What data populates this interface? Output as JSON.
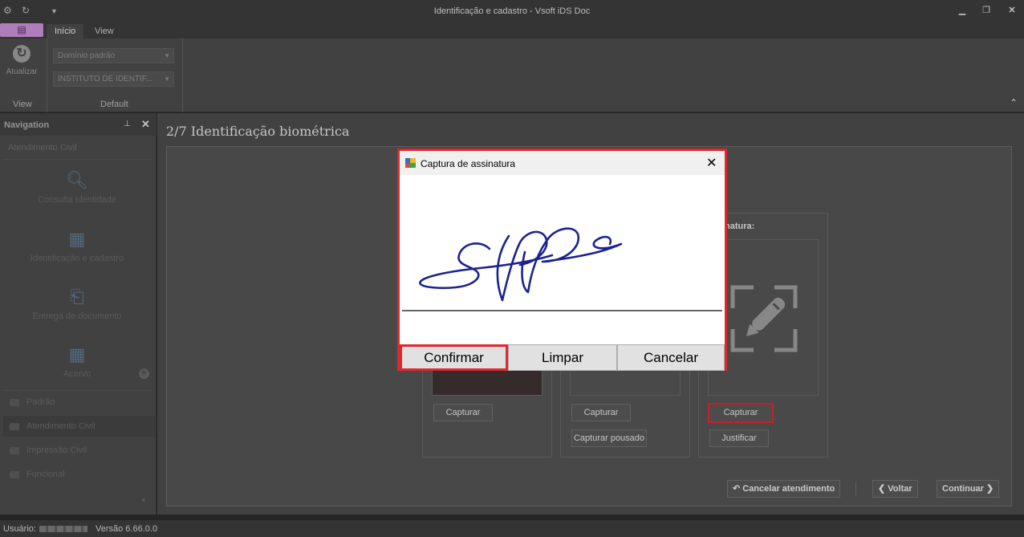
{
  "window": {
    "title": "Identificação e cadastro - Vsoft iDS Doc",
    "controls": [
      "minimize-icon",
      "restore-icon",
      "close-icon"
    ]
  },
  "quick_access": [
    "app-icon",
    "undo-icon",
    "dropdown-icon"
  ],
  "ribbon": {
    "file_button_icon": "document-icon",
    "tabs": [
      {
        "label": "Início",
        "active": true
      },
      {
        "label": "View",
        "active": false
      }
    ],
    "refresh_label": "Atualizar",
    "domain_combo": "Domínio padrão",
    "institute_combo": "INSTITUTO DE IDENTIF...",
    "group_view": "View",
    "group_default": "Default"
  },
  "navigation": {
    "title": "Navigation",
    "section": "Atendimento Civil",
    "items": [
      {
        "label": "Consulta Identidade",
        "icon": "search-icon"
      },
      {
        "label": "Identificação e cadastro",
        "icon": "id-card-icon"
      },
      {
        "label": "Entrega de documento",
        "icon": "document-delivery-icon"
      },
      {
        "label": "Acervo",
        "icon": "archive-icon"
      }
    ],
    "groups": [
      {
        "label": "Padrão",
        "selected": false
      },
      {
        "label": "Atendimento Civil",
        "selected": true
      },
      {
        "label": "Impressão Civil",
        "selected": false
      },
      {
        "label": "Funcional",
        "selected": false
      }
    ]
  },
  "main": {
    "page_title": "2/7 Identificação biométrica",
    "photo_card": {
      "capture_label": "Capturar"
    },
    "fingerprint_card": {
      "capture_label": "Capturar",
      "capture_posed_label": "Capturar pousado"
    },
    "signature_card": {
      "title_visible": "natura:",
      "capture_label": "Capturar",
      "justify_label": "Justificar"
    },
    "footer": {
      "cancel_label": "Cancelar atendimento",
      "back_label": "Voltar",
      "continue_label": "Continuar"
    }
  },
  "dialog": {
    "title": "Captura de assinatura",
    "confirm_label": "Confirmar",
    "clear_label": "Limpar",
    "cancel_label": "Cancelar",
    "ink_color": "#1a2390"
  },
  "status": {
    "user_label": "Usuário:",
    "version": "Versão 6.66.0.0"
  },
  "colors": {
    "highlight": "#e0262e",
    "file_tab": "#c88fd4"
  }
}
